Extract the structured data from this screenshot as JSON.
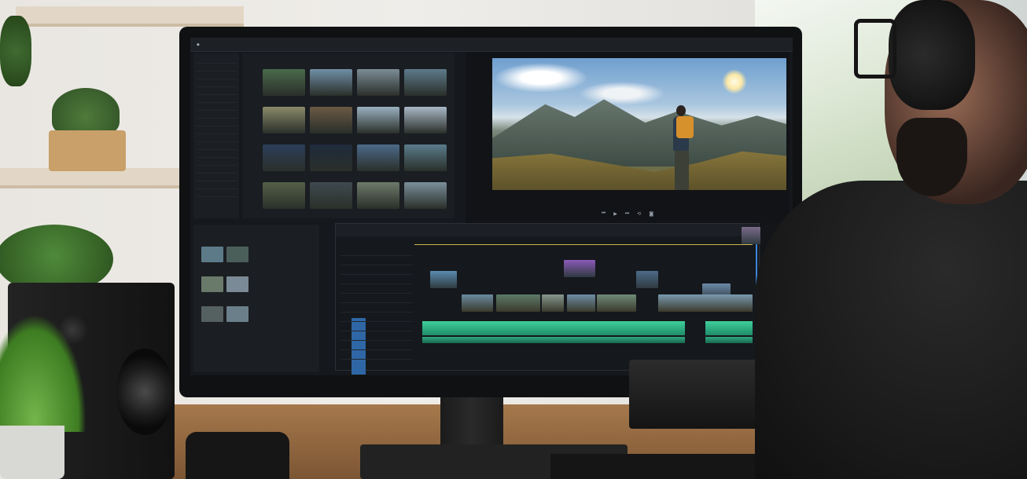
{
  "scene": {
    "description_type": "photo",
    "colors": {
      "accent_timeline": "#3fcf9b",
      "playhead": "#3a86d8",
      "backpack": "#d6902c"
    }
  },
  "app": {
    "menu_items": [
      "",
      "",
      "",
      "",
      "",
      "",
      ""
    ],
    "transport_icons": [
      "step-back-icon",
      "play-icon",
      "step-forward-icon",
      "loop-icon",
      "camera-icon"
    ]
  },
  "project_panel": {
    "rows": [
      "",
      "",
      "",
      "",
      "",
      "",
      "",
      "",
      "",
      "",
      "",
      "",
      "",
      "",
      "",
      "",
      "",
      ""
    ]
  },
  "media_browser": {
    "thumbnails": [
      {
        "label": "",
        "color": "#4a6a4a"
      },
      {
        "label": "",
        "color": "#6f8fa6"
      },
      {
        "label": "",
        "color": "#7c8c95"
      },
      {
        "label": "",
        "color": "#5e7a8a"
      },
      {
        "label": "",
        "color": "#8a8a6a"
      },
      {
        "label": "",
        "color": "#6a5a45"
      },
      {
        "label": "",
        "color": "#9ab0c0"
      },
      {
        "label": "",
        "color": "#a9b8c6"
      },
      {
        "label": "",
        "color": "#2c3e5a"
      },
      {
        "label": "",
        "color": "#1f2b3d"
      },
      {
        "label": "",
        "color": "#4d6a8a"
      },
      {
        "label": "",
        "color": "#5a7c8c"
      },
      {
        "label": "",
        "color": "#556048"
      },
      {
        "label": "",
        "color": "#3f4a4f"
      },
      {
        "label": "",
        "color": "#6c7a6a"
      },
      {
        "label": "",
        "color": "#7a8f9a"
      }
    ]
  },
  "timeline": {
    "clips_v2": [
      {
        "color": "#5a8bb0"
      },
      {
        "color": "#8a5ab8"
      },
      {
        "color": "#4d6b8a"
      },
      {
        "color": "#6b8aa8"
      },
      {
        "color": "#7a6a8a"
      }
    ],
    "clips_v1": [
      {
        "color": "#6a8aa0"
      },
      {
        "color": "#5d7a68"
      },
      {
        "color": "#86978e"
      },
      {
        "color": "#6e8ea6"
      },
      {
        "color": "#708a78"
      },
      {
        "color": "#7a9ab0"
      }
    ]
  }
}
